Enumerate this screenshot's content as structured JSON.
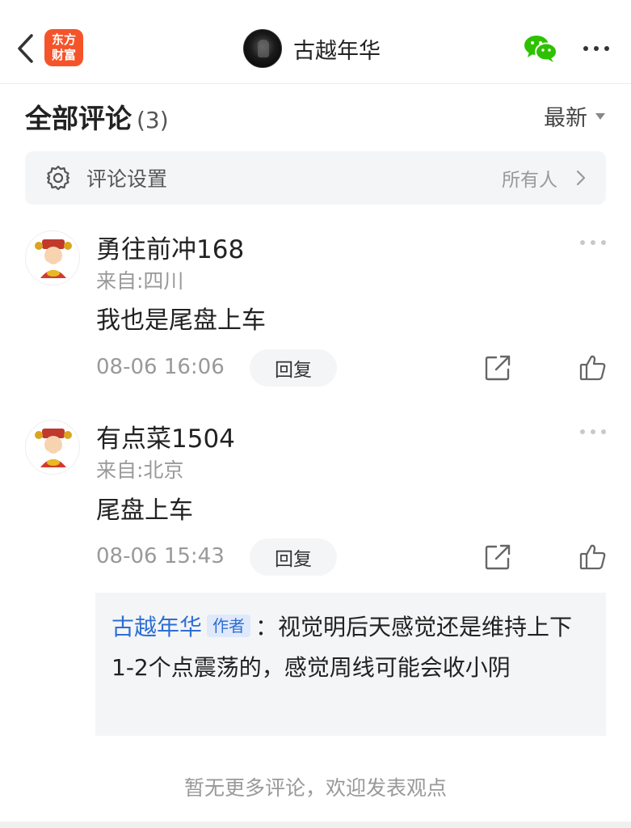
{
  "header": {
    "app_logo_line1": "东方",
    "app_logo_line2": "财富",
    "author_name": "古越年华"
  },
  "comments_section": {
    "title": "全部评论",
    "count": "(3)",
    "sort_label": "最新"
  },
  "settings": {
    "label": "评论设置",
    "value": "所有人"
  },
  "comments": [
    {
      "user": "勇往前冲168",
      "from": "来自:四川",
      "text": "我也是尾盘上车",
      "time": "08-06 16:06",
      "reply_label": "回复"
    },
    {
      "user": "有点菜1504",
      "from": "来自:北京",
      "text": "尾盘上车",
      "time": "08-06 15:43",
      "reply_label": "回复",
      "reply": {
        "author": "古越年华",
        "author_tag": "作者",
        "separator": "：",
        "text": "视觉明后天感觉还是维持上下1-2个点震荡的，感觉周线可能会收小阴"
      }
    }
  ],
  "footer": {
    "note": "暂无更多评论，欢迎发表观点"
  },
  "colors": {
    "brand_orange": "#f5542b",
    "link_blue": "#2e6fd4",
    "wechat_green": "#2dc100"
  }
}
